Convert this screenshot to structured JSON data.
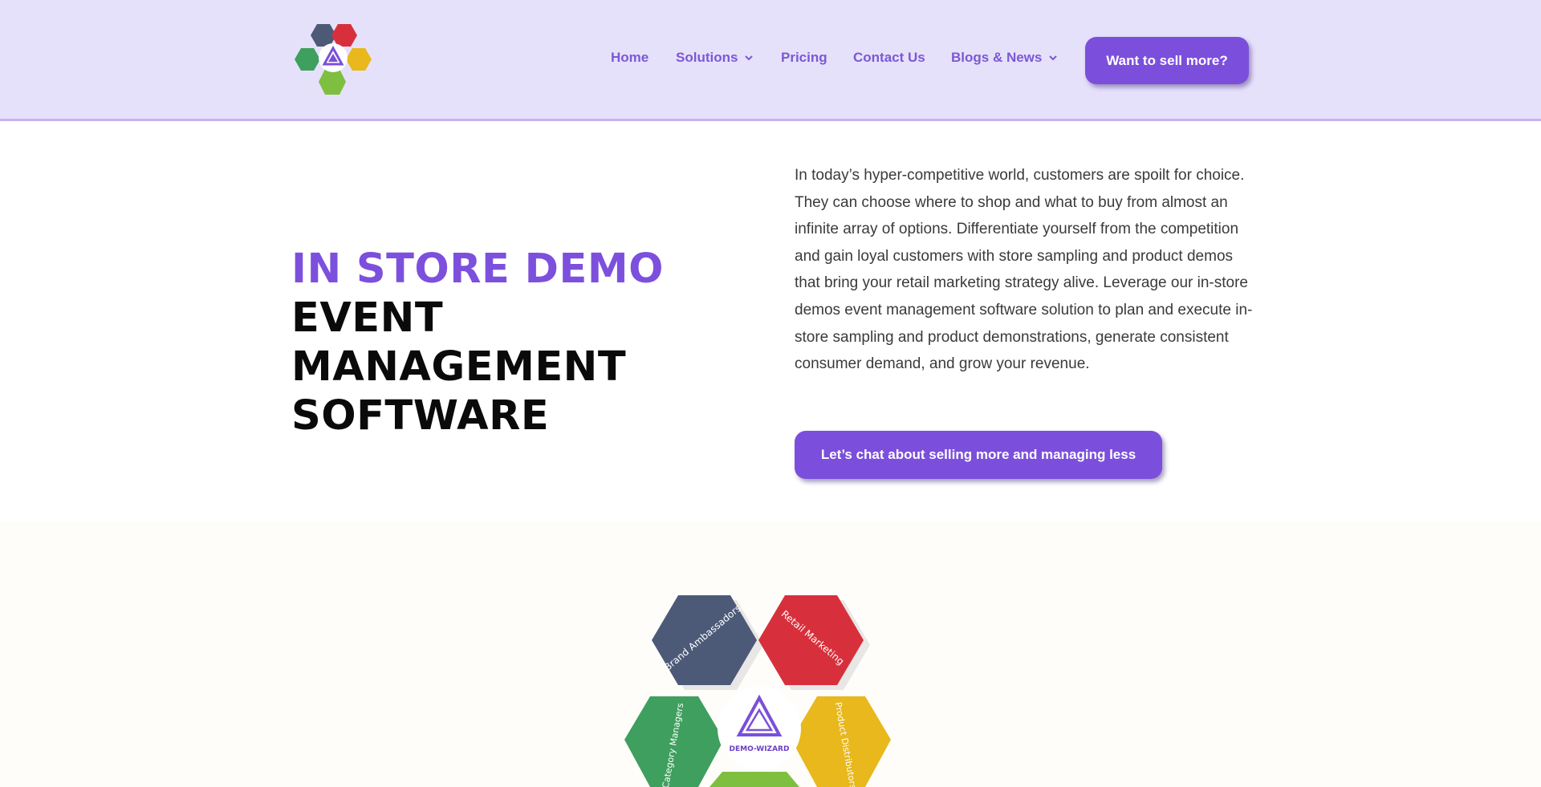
{
  "header": {
    "nav": [
      {
        "label": "Home",
        "has_dropdown": false
      },
      {
        "label": "Solutions",
        "has_dropdown": true
      },
      {
        "label": "Pricing",
        "has_dropdown": false
      },
      {
        "label": "Contact Us",
        "has_dropdown": false
      },
      {
        "label": "Blogs & News",
        "has_dropdown": true
      }
    ],
    "cta_label": "Want to sell more?"
  },
  "hero": {
    "headline_accent": "IN STORE DEMO",
    "headline_line2": "EVENT MANAGEMENT",
    "headline_line3": "SOFTWARE",
    "body": "In today’s hyper-competitive world, customers are spoilt for choice. They can choose where to shop and what to buy from almost an infinite array of options. Differentiate yourself from the competition and gain loyal customers with store sampling and product demos that bring your retail marketing strategy alive. Leverage our in-store demos event management software solution to plan and execute in-store sampling and product demonstrations, generate consistent consumer demand, and grow your revenue.",
    "cta_label": "Let’s chat about selling more and managing less"
  },
  "puzzle": {
    "pieces": [
      "Brand Ambassadors",
      "Retail Marketing",
      "Category Managers",
      "Product Distributors"
    ],
    "center_label": "DEMO-WIZARD"
  },
  "colors": {
    "accent": "#7b4fdb",
    "header_bg": "#e6e1fa",
    "nav_text": "#7b58d6",
    "piece_gray": "#4c5a78",
    "piece_red": "#d7303c",
    "piece_green": "#3f9f5e",
    "piece_yellow": "#e8b81c",
    "piece_lime": "#7fbf3f"
  },
  "icons": {
    "logo": "puzzle-logo-icon",
    "dropdown": "chevron-down-icon"
  }
}
